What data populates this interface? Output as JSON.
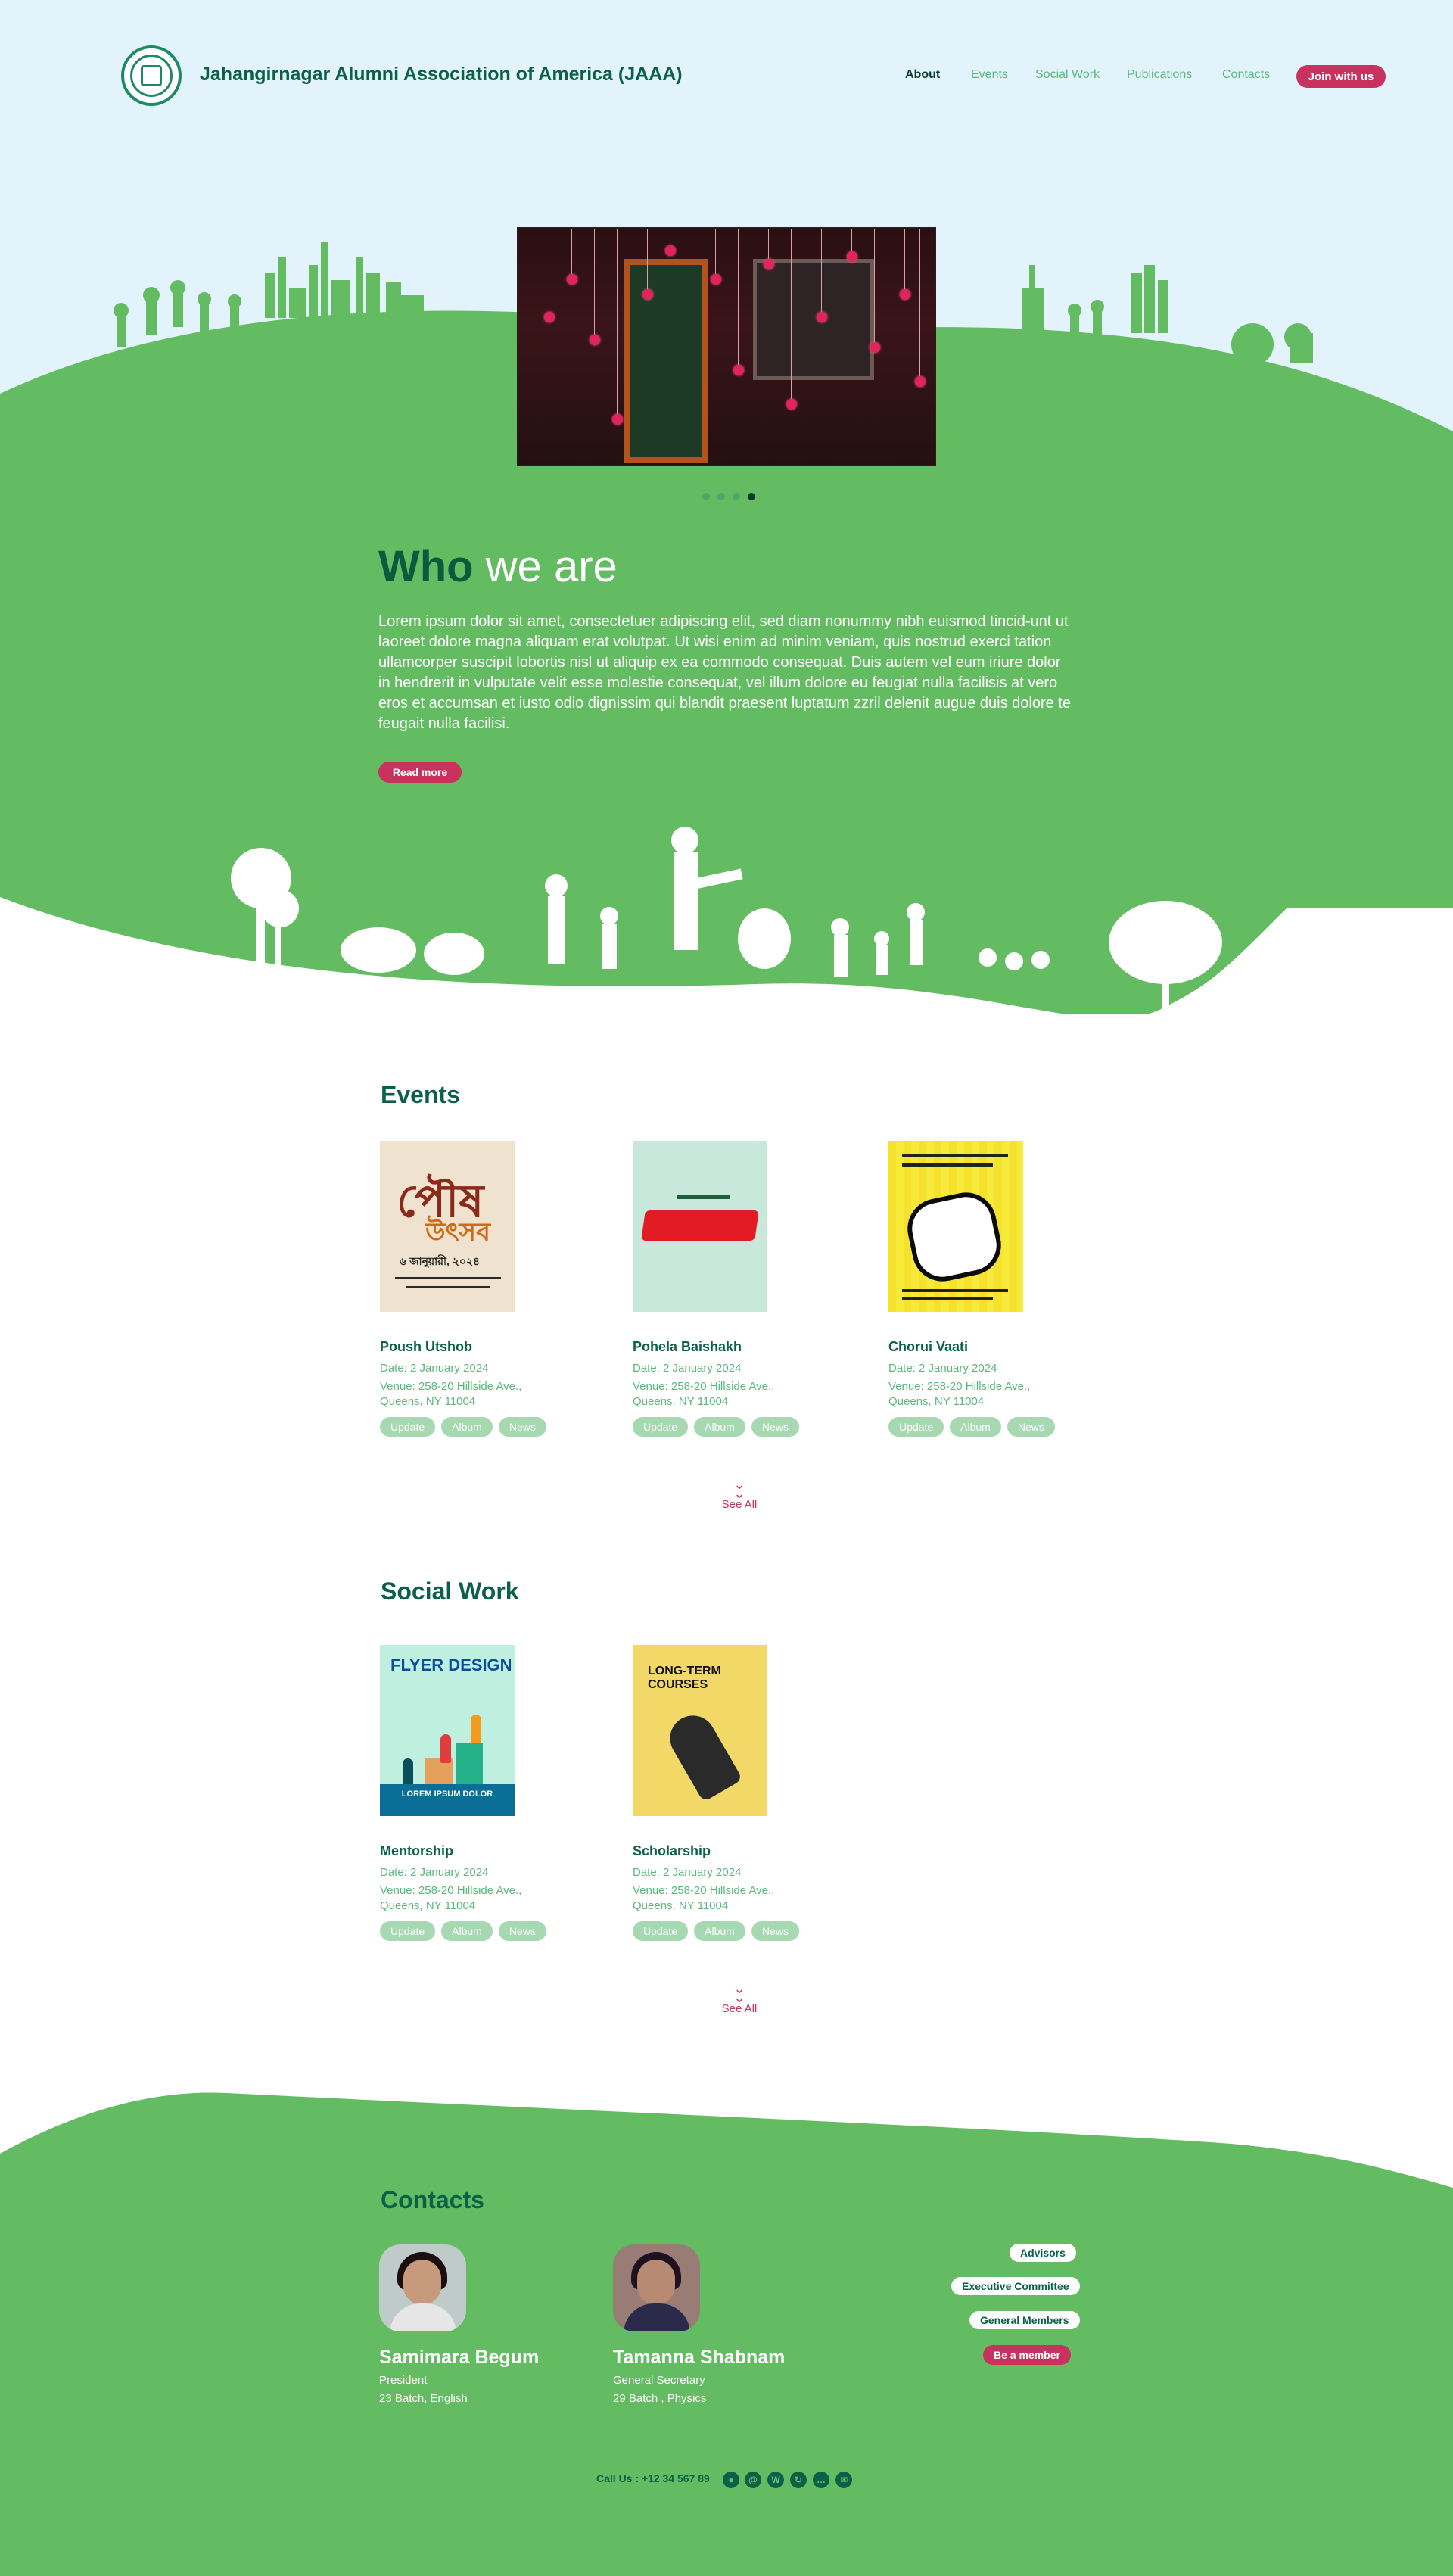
{
  "header": {
    "brand": "Jahangirnagar Alumni Association of America (JAAA)",
    "nav": [
      "About",
      "Events",
      "Social Work",
      "Publications",
      "Contacts"
    ],
    "join_label": "Join with us"
  },
  "hero": {
    "active_slide": 4,
    "slide_count": 4
  },
  "about": {
    "title_bold": "Who",
    "title_rest": " we are",
    "body": "Lorem ipsum dolor sit amet, consectetuer adipiscing elit, sed diam nonummy nibh euismod tincid-unt ut laoreet dolore magna aliquam erat volutpat. Ut wisi enim ad minim veniam, quis nostrud exerci tation ullamcorper suscipit lobortis nisl ut aliquip ex ea commodo consequat. Duis autem vel eum iriure dolor in hendrerit in vulputate velit esse molestie consequat, vel illum dolore eu feugiat nulla facilisis at vero eros et accumsan et iusto odio dignissim qui blandit praesent luptatum zzril delenit augue duis dolore te feugait nulla facilisi.",
    "read_more": "Read more"
  },
  "events": {
    "title": "Events",
    "items": [
      {
        "name": "Poush Utshob",
        "date": "Date: 2 January 2024",
        "venue1": "Venue: 258-20 Hillside Ave.,",
        "venue2": "Queens, NY 11004"
      },
      {
        "name": "Pohela Baishakh",
        "date": "Date: 2 January 2024",
        "venue1": "Venue: 258-20 Hillside Ave.,",
        "venue2": "Queens, NY 11004"
      },
      {
        "name": "Chorui Vaati",
        "date": "Date: 2 January 2024",
        "venue1": "Venue: 258-20 Hillside Ave.,",
        "venue2": "Queens, NY 11004"
      }
    ],
    "see_all": "See All"
  },
  "social": {
    "title": "Social Work",
    "items": [
      {
        "name": "Mentorship",
        "date": "Date: 2 January 2024",
        "venue1": "Venue: 258-20 Hillside Ave.,",
        "venue2": "Queens, NY 11004"
      },
      {
        "name": "Scholarship",
        "date": "Date: 2 January 2024",
        "venue1": "Venue: 258-20 Hillside Ave.,",
        "venue2": "Queens, NY 11004"
      }
    ],
    "see_all": "See All"
  },
  "tags": [
    "Update",
    "Album",
    "News"
  ],
  "posters": {
    "poush_line": "৬ জানুয়ারী, ২০২৪",
    "flyer_title": "FLYER DESIGN",
    "flyer_bottom": "LOREM IPSUM DOLOR",
    "courses_title": "LONG-TERM COURSES"
  },
  "contacts": {
    "title": "Contacts",
    "people": [
      {
        "name": "Samimara Begum",
        "role": "President",
        "batch": "23 Batch, English"
      },
      {
        "name": "Tamanna Shabnam",
        "role": "General Secretary",
        "batch": "29 Batch , Physics"
      }
    ],
    "links": [
      "Advisors",
      "Executive Committee",
      "General Members"
    ],
    "member_label": "Be a member",
    "call": "Call Us : +12 34 567 89",
    "social_icons": [
      "user-icon",
      "at-icon",
      "w-icon",
      "refresh-icon",
      "chat-icon",
      "mail-icon"
    ]
  },
  "colors": {
    "green": "#64bc62",
    "dark_green": "#0b6148",
    "pink": "#c8325f",
    "sky": "#e3f3fb"
  }
}
